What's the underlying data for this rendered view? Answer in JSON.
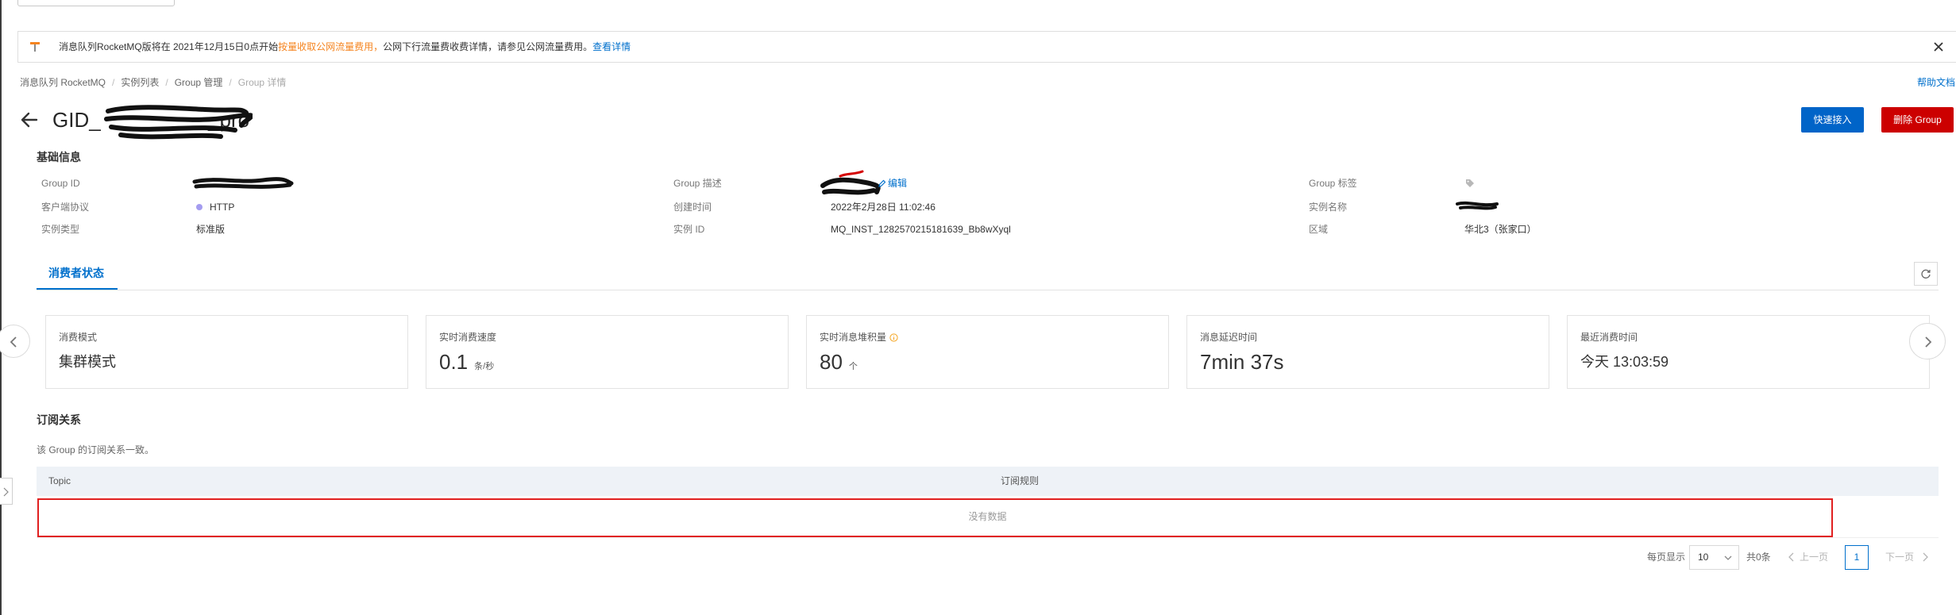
{
  "banner": {
    "text_before": "消息队列RocketMQ版将在 2021年12月15日0点开始",
    "text_highlight": "按量收取公网流量费用，",
    "text_after": "公网下行流量费收费详情，请参见公网流量费用。",
    "link": "查看详情"
  },
  "breadcrumb": {
    "items": [
      "消息队列 RocketMQ",
      "实例列表",
      "Group 管理",
      "Group 详情"
    ],
    "separator": "/"
  },
  "help_link": "帮助文档",
  "title": {
    "prefix": "GID_",
    "suffix": "_pro"
  },
  "actions": {
    "quick_access": "快速接入",
    "delete_group": "删除 Group"
  },
  "basic_info": {
    "heading": "基础信息",
    "group_id": {
      "label": "Group ID"
    },
    "protocol": {
      "label": "客户端协议",
      "value": "HTTP"
    },
    "instance_type": {
      "label": "实例类型",
      "value": "标准版"
    },
    "group_desc": {
      "label": "Group 描述",
      "edit": "编辑"
    },
    "created_at": {
      "label": "创建时间",
      "value": "2022年2月28日 11:02:46"
    },
    "instance_id": {
      "label": "实例 ID",
      "value": "MQ_INST_1282570215181639_Bb8wXyql"
    },
    "group_tags": {
      "label": "Group 标签"
    },
    "instance_name": {
      "label": "实例名称"
    },
    "region": {
      "label": "区域",
      "value": "华北3（张家口）"
    }
  },
  "tabs": [
    {
      "label": "消费者状态",
      "active": true
    }
  ],
  "metrics": [
    {
      "label": "消费模式",
      "value": "集群模式"
    },
    {
      "label": "实时消费速度",
      "value": "0.1",
      "unit": "条/秒"
    },
    {
      "label": "实时消息堆积量",
      "value": "80",
      "unit": "个"
    },
    {
      "label": "消息延迟时间",
      "value": "7min 37s"
    },
    {
      "label": "最近消费时间",
      "value": "今天 13:03:59"
    }
  ],
  "subscription": {
    "heading": "订阅关系",
    "note": "该 Group 的订阅关系一致。",
    "columns": [
      "Topic",
      "订阅规则"
    ],
    "empty_text": "没有数据"
  },
  "pagination": {
    "page_size_label": "每页显示",
    "page_size": "10",
    "total": "共0条",
    "prev": "上一页",
    "current_page": "1",
    "next": "下一页"
  },
  "icons": {
    "banner": "announcement-icon",
    "close": "close-icon",
    "back": "back-arrow-icon",
    "edit": "pencil-icon",
    "tag": "tag-icon",
    "refresh": "refresh-icon",
    "info": "info-icon",
    "carousel_prev": "chevron-left-icon",
    "carousel_next": "chevron-right-icon"
  },
  "colors": {
    "primary": "#0070cc",
    "button_primary": "#0064c8",
    "danger": "#cc0000",
    "highlight": "#f5841f",
    "annotation": "#e02020",
    "protocol_dot": "#a49cf0",
    "warning_icon": "#f5a623"
  }
}
